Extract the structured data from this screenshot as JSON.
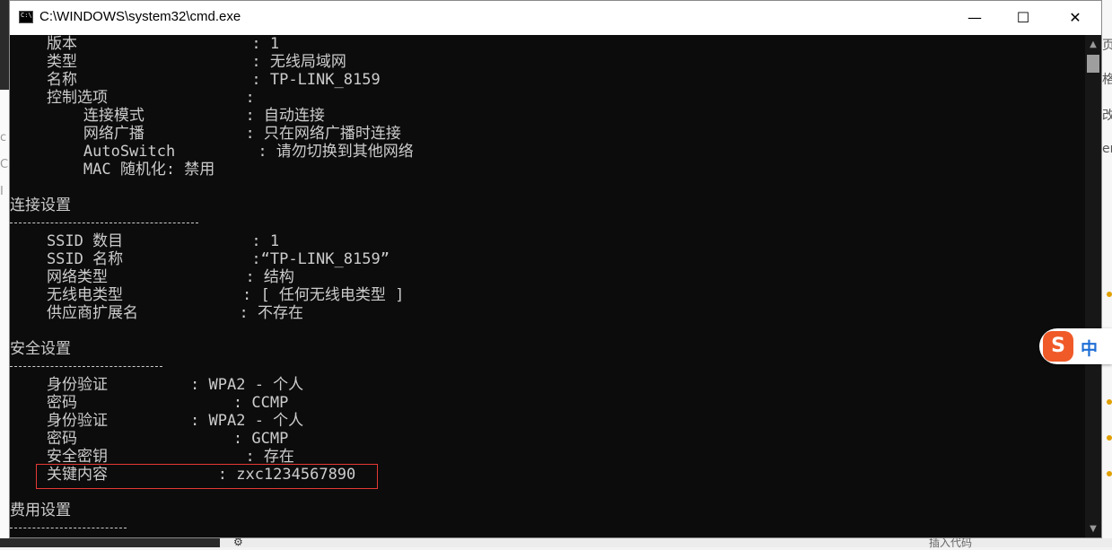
{
  "window": {
    "title": "C:\\WINDOWS\\system32\\cmd.exe",
    "minimize_glyph": "—",
    "maximize_glyph": "☐",
    "close_glyph": "✕",
    "app_icon_text": "C:\\"
  },
  "console_lines": [
    "    版本                   : 1",
    "    类型                   : 无线局域网",
    "    名称                   : TP-LINK_8159",
    "    控制选项               :",
    "        连接模式           : 自动连接",
    "        网络广播           : 只在网络广播时连接",
    "        AutoSwitch         : 请勿切换到其他网络",
    "        MAC 随机化: 禁用",
    "",
    "连接设置",
    "",
    "    SSID 数目              : 1",
    "    SSID 名称              :“TP-LINK_8159”",
    "    网络类型               : 结构",
    "    无线电类型             : [ 任何无线电类型 ]",
    "    供应商扩展名           : 不存在",
    "",
    "安全设置",
    "",
    "    身份验证         : WPA2 - 个人",
    "    密码                 : CCMP",
    "    身份验证         : WPA2 - 个人",
    "    密码                 : GCMP",
    "    安全密钥               : 存在",
    "    关键内容            : zxc1234567890",
    "",
    "费用设置"
  ],
  "scrollbar": {
    "up_glyph": "▲",
    "down_glyph": "▼"
  },
  "ime": {
    "logo": "S",
    "mode": "中"
  },
  "background": {
    "left_fragments": [
      "c",
      "C",
      "I"
    ],
    "right_fragments": [
      "页",
      "格",
      "改",
      "er"
    ],
    "bottom_gear": "⚙",
    "bottom_text": "插入代码"
  }
}
